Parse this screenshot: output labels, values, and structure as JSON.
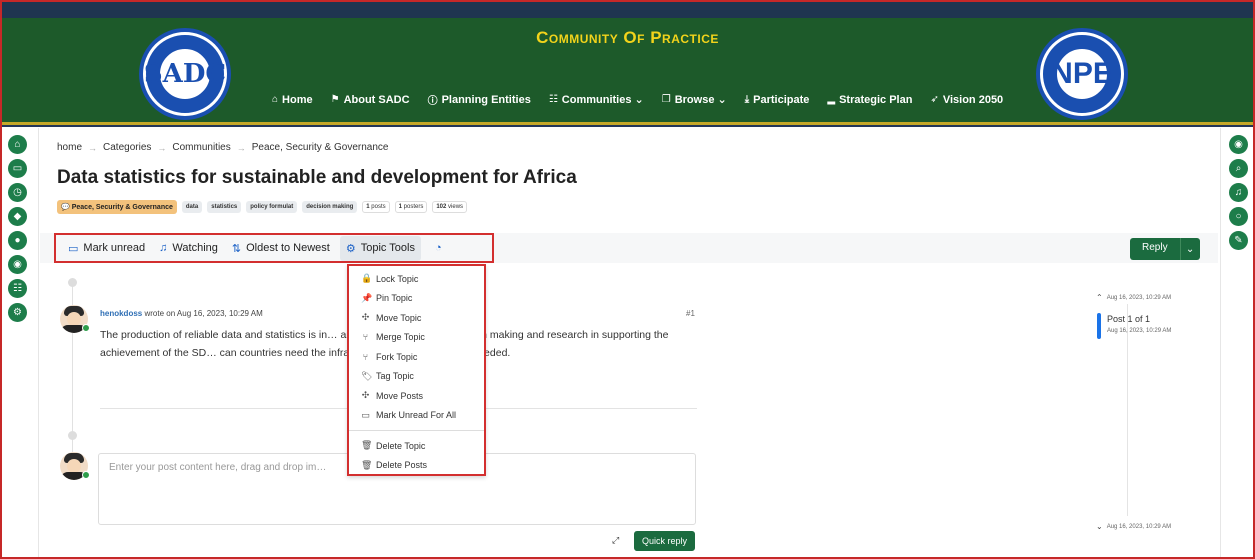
{
  "header": {
    "brand": "Community Of Practice",
    "logo_left_text": "SADC",
    "logo_right_text": "NPE",
    "nav": [
      {
        "icon": "⌂",
        "label": "Home"
      },
      {
        "icon": "⚑",
        "label": "About SADC"
      },
      {
        "icon": "ⓘ",
        "label": "Planning Entities"
      },
      {
        "icon": "☷",
        "label": "Communities ⌄"
      },
      {
        "icon": "❐",
        "label": "Browse ⌄"
      },
      {
        "icon": "⤓",
        "label": "Participate"
      },
      {
        "icon": "▂",
        "label": "Strategic Plan"
      },
      {
        "icon": "➶",
        "label": "Vision 2050"
      }
    ]
  },
  "breadcrumb": [
    "home",
    "Categories",
    "Communities",
    "Peace, Security & Governance"
  ],
  "topic": {
    "title": "Data statistics for sustainable and development for Africa",
    "category": "Peace, Security & Governance",
    "tags": [
      "data",
      "statistics",
      "policy formulat",
      "decision making"
    ],
    "stats": {
      "posts_num": "1",
      "posts_label": "posts",
      "posters_num": "1",
      "posters_label": "posters",
      "views_num": "102",
      "views_label": "views"
    }
  },
  "toolbar": {
    "mark_unread": "Mark unread",
    "watching": "Watching",
    "sort": "Oldest to Newest",
    "topic_tools": "Topic Tools",
    "reply": "Reply"
  },
  "topic_tools_menu": [
    {
      "icon": "🔒",
      "label": "Lock Topic"
    },
    {
      "icon": "📌",
      "label": "Pin Topic"
    },
    {
      "icon": "✣",
      "label": "Move Topic"
    },
    {
      "icon": "⑂",
      "label": "Merge Topic"
    },
    {
      "icon": "⑂",
      "label": "Fork Topic"
    },
    {
      "icon": "🏷",
      "label": "Tag Topic"
    },
    {
      "icon": "✣",
      "label": "Move Posts"
    },
    {
      "icon": "▭",
      "label": "Mark Unread For All"
    }
  ],
  "topic_tools_danger": [
    {
      "icon": "🗑",
      "label": "Delete Topic"
    },
    {
      "icon": "🗑",
      "label": "Delete Posts"
    }
  ],
  "post": {
    "author": "henokdoss",
    "meta": "wrote on Aug 16, 2023, 10:29 AM",
    "number": "#1",
    "body": "The production of reliable data and statistics is in… and policy formulation, decision making and research in supporting the achievement of the SD… can countries need the infrastructure and the capacity needed."
  },
  "composer": {
    "placeholder": "Enter your post content here, drag and drop im…",
    "quick_reply": "Quick reply"
  },
  "pagination": {
    "top_date": "Aug 16, 2023, 10:29 AM",
    "current": "Post 1 of 1",
    "current_date": "Aug 16, 2023, 10:29 AM",
    "bottom_date": "Aug 16, 2023, 10:29 AM"
  },
  "colors": {
    "header_green": "#1d5a2a",
    "brand_gold": "#f2d31b",
    "accent_green": "#1b6b3f",
    "highlight_red": "#d32f2f",
    "link_blue": "#1a60c6"
  }
}
